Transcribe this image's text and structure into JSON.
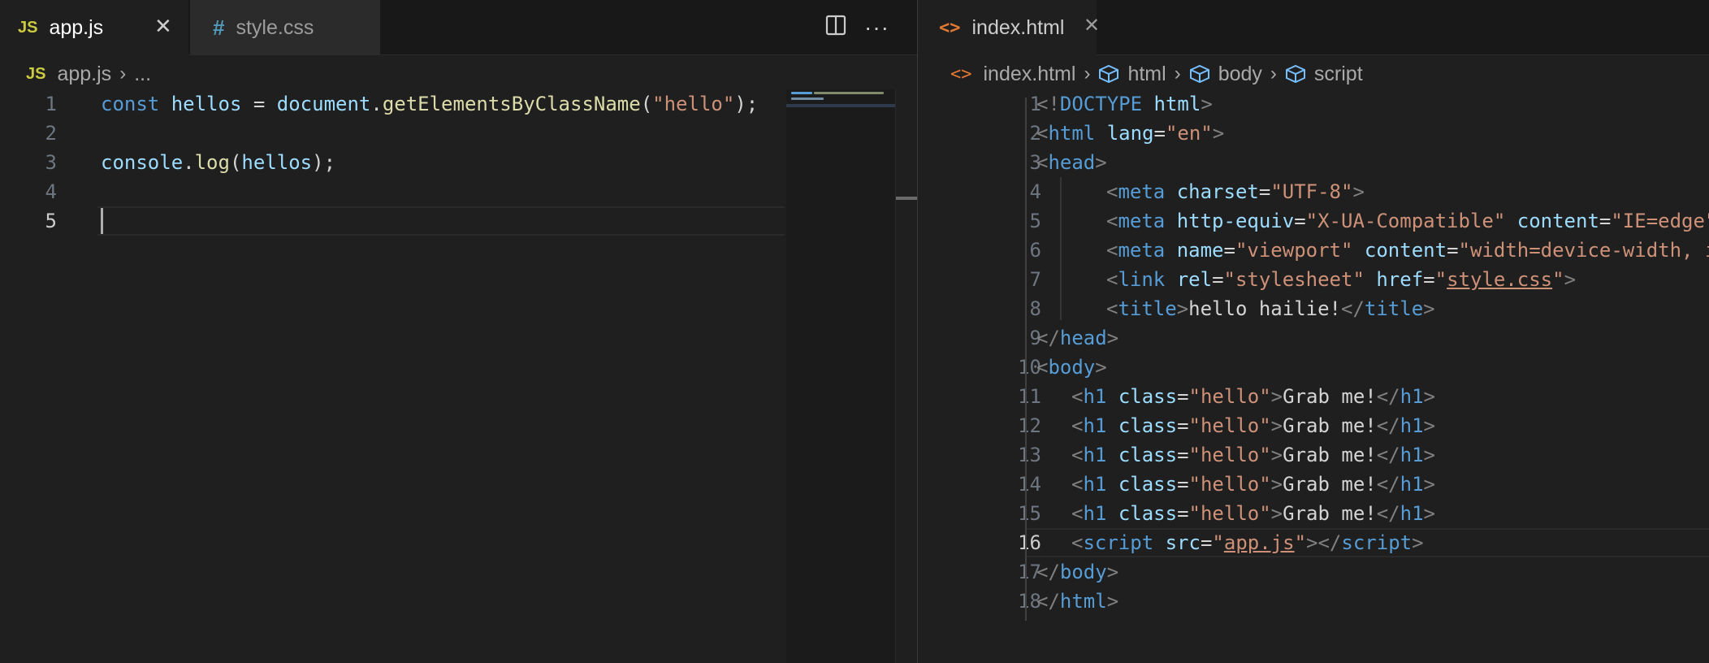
{
  "left": {
    "tabs": [
      {
        "label": "app.js",
        "icon": "js-icon",
        "icon_text": "JS",
        "active": true,
        "close": "✕"
      },
      {
        "label": "style.css",
        "icon": "hash-icon",
        "icon_text": "#",
        "active": false
      }
    ],
    "actions": {
      "split_icon": "split-editor-icon",
      "more": "···"
    },
    "breadcrumb": {
      "file_icon_text": "JS",
      "file": "app.js",
      "sep": "›",
      "rest": "..."
    },
    "lines": [
      {
        "n": "1",
        "tokens": [
          [
            "const",
            "kw"
          ],
          [
            " ",
            "plain"
          ],
          [
            "hellos",
            "var"
          ],
          [
            " = ",
            "plain"
          ],
          [
            "document",
            "var"
          ],
          [
            ".",
            "plain"
          ],
          [
            "getElementsByClassName",
            "fn"
          ],
          [
            "(",
            "plain"
          ],
          [
            "\"hello\"",
            "str"
          ],
          [
            ");",
            "plain"
          ]
        ]
      },
      {
        "n": "2",
        "tokens": []
      },
      {
        "n": "3",
        "tokens": [
          [
            "console",
            "var"
          ],
          [
            ".",
            "plain"
          ],
          [
            "log",
            "fn"
          ],
          [
            "(",
            "plain"
          ],
          [
            "hellos",
            "var"
          ],
          [
            ");",
            "plain"
          ]
        ]
      },
      {
        "n": "4",
        "tokens": []
      },
      {
        "n": "5",
        "tokens": [],
        "current": true
      }
    ]
  },
  "right": {
    "tabs": [
      {
        "label": "index.html",
        "icon": "html-icon",
        "icon_text": "<>",
        "active": true,
        "close": "✕"
      }
    ],
    "breadcrumb": {
      "file_icon_text": "<>",
      "file": "index.html",
      "sep": "›",
      "items": [
        "html",
        "body",
        "script"
      ]
    },
    "lines": [
      {
        "n": "1",
        "indent": 0,
        "tokens": [
          [
            "<!",
            "punct"
          ],
          [
            "DOCTYPE",
            "tag"
          ],
          [
            " ",
            "plain"
          ],
          [
            "html",
            "attr"
          ],
          [
            ">",
            "punct"
          ]
        ]
      },
      {
        "n": "2",
        "indent": 0,
        "tokens": [
          [
            "<",
            "punct"
          ],
          [
            "html",
            "tag"
          ],
          [
            " ",
            "plain"
          ],
          [
            "lang",
            "attr"
          ],
          [
            "=",
            "plain"
          ],
          [
            "\"en\"",
            "str"
          ],
          [
            ">",
            "punct"
          ]
        ]
      },
      {
        "n": "3",
        "indent": 0,
        "tokens": [
          [
            "<",
            "punct"
          ],
          [
            "head",
            "tag"
          ],
          [
            ">",
            "punct"
          ]
        ]
      },
      {
        "n": "4",
        "indent": 2,
        "tokens": [
          [
            "<",
            "punct"
          ],
          [
            "meta",
            "tag"
          ],
          [
            " ",
            "plain"
          ],
          [
            "charset",
            "attr"
          ],
          [
            "=",
            "plain"
          ],
          [
            "\"UTF-8\"",
            "str"
          ],
          [
            ">",
            "punct"
          ]
        ]
      },
      {
        "n": "5",
        "indent": 2,
        "tokens": [
          [
            "<",
            "punct"
          ],
          [
            "meta",
            "tag"
          ],
          [
            " ",
            "plain"
          ],
          [
            "http-equiv",
            "attr"
          ],
          [
            "=",
            "plain"
          ],
          [
            "\"X-UA-Compatible\"",
            "str"
          ],
          [
            " ",
            "plain"
          ],
          [
            "content",
            "attr"
          ],
          [
            "=",
            "plain"
          ],
          [
            "\"IE=edge\"",
            "str"
          ],
          [
            ">",
            "punct"
          ]
        ]
      },
      {
        "n": "6",
        "indent": 2,
        "tokens": [
          [
            "<",
            "punct"
          ],
          [
            "meta",
            "tag"
          ],
          [
            " ",
            "plain"
          ],
          [
            "name",
            "attr"
          ],
          [
            "=",
            "plain"
          ],
          [
            "\"viewport\"",
            "str"
          ],
          [
            " ",
            "plain"
          ],
          [
            "content",
            "attr"
          ],
          [
            "=",
            "plain"
          ],
          [
            "\"width=device-width, in",
            "str"
          ]
        ]
      },
      {
        "n": "7",
        "indent": 2,
        "tokens": [
          [
            "<",
            "punct"
          ],
          [
            "link",
            "tag"
          ],
          [
            " ",
            "plain"
          ],
          [
            "rel",
            "attr"
          ],
          [
            "=",
            "plain"
          ],
          [
            "\"stylesheet\"",
            "str"
          ],
          [
            " ",
            "plain"
          ],
          [
            "href",
            "attr"
          ],
          [
            "=",
            "plain"
          ],
          [
            "\"",
            "str"
          ],
          [
            "style.css",
            "link"
          ],
          [
            "\"",
            "str"
          ],
          [
            ">",
            "punct"
          ]
        ]
      },
      {
        "n": "8",
        "indent": 2,
        "tokens": [
          [
            "<",
            "punct"
          ],
          [
            "title",
            "tag"
          ],
          [
            ">",
            "punct"
          ],
          [
            "hello hailie!",
            "plain"
          ],
          [
            "</",
            "punct"
          ],
          [
            "title",
            "tag"
          ],
          [
            ">",
            "punct"
          ]
        ]
      },
      {
        "n": "9",
        "indent": 0,
        "tokens": [
          [
            "</",
            "punct"
          ],
          [
            "head",
            "tag"
          ],
          [
            ">",
            "punct"
          ]
        ]
      },
      {
        "n": "10",
        "indent": 0,
        "tokens": [
          [
            "<",
            "punct"
          ],
          [
            "body",
            "tag"
          ],
          [
            ">",
            "punct"
          ]
        ]
      },
      {
        "n": "11",
        "indent": 1,
        "tokens": [
          [
            "<",
            "punct"
          ],
          [
            "h1",
            "tag"
          ],
          [
            " ",
            "plain"
          ],
          [
            "class",
            "attr"
          ],
          [
            "=",
            "plain"
          ],
          [
            "\"hello\"",
            "str"
          ],
          [
            ">",
            "punct"
          ],
          [
            "Grab me!",
            "plain"
          ],
          [
            "</",
            "punct"
          ],
          [
            "h1",
            "tag"
          ],
          [
            ">",
            "punct"
          ]
        ]
      },
      {
        "n": "12",
        "indent": 1,
        "tokens": [
          [
            "<",
            "punct"
          ],
          [
            "h1",
            "tag"
          ],
          [
            " ",
            "plain"
          ],
          [
            "class",
            "attr"
          ],
          [
            "=",
            "plain"
          ],
          [
            "\"hello\"",
            "str"
          ],
          [
            ">",
            "punct"
          ],
          [
            "Grab me!",
            "plain"
          ],
          [
            "</",
            "punct"
          ],
          [
            "h1",
            "tag"
          ],
          [
            ">",
            "punct"
          ]
        ]
      },
      {
        "n": "13",
        "indent": 1,
        "tokens": [
          [
            "<",
            "punct"
          ],
          [
            "h1",
            "tag"
          ],
          [
            " ",
            "plain"
          ],
          [
            "class",
            "attr"
          ],
          [
            "=",
            "plain"
          ],
          [
            "\"hello\"",
            "str"
          ],
          [
            ">",
            "punct"
          ],
          [
            "Grab me!",
            "plain"
          ],
          [
            "</",
            "punct"
          ],
          [
            "h1",
            "tag"
          ],
          [
            ">",
            "punct"
          ]
        ]
      },
      {
        "n": "14",
        "indent": 1,
        "tokens": [
          [
            "<",
            "punct"
          ],
          [
            "h1",
            "tag"
          ],
          [
            " ",
            "plain"
          ],
          [
            "class",
            "attr"
          ],
          [
            "=",
            "plain"
          ],
          [
            "\"hello\"",
            "str"
          ],
          [
            ">",
            "punct"
          ],
          [
            "Grab me!",
            "plain"
          ],
          [
            "</",
            "punct"
          ],
          [
            "h1",
            "tag"
          ],
          [
            ">",
            "punct"
          ]
        ]
      },
      {
        "n": "15",
        "indent": 1,
        "tokens": [
          [
            "<",
            "punct"
          ],
          [
            "h1",
            "tag"
          ],
          [
            " ",
            "plain"
          ],
          [
            "class",
            "attr"
          ],
          [
            "=",
            "plain"
          ],
          [
            "\"hello\"",
            "str"
          ],
          [
            ">",
            "punct"
          ],
          [
            "Grab me!",
            "plain"
          ],
          [
            "</",
            "punct"
          ],
          [
            "h1",
            "tag"
          ],
          [
            ">",
            "punct"
          ]
        ]
      },
      {
        "n": "16",
        "indent": 1,
        "current": true,
        "tokens": [
          [
            "<",
            "punct"
          ],
          [
            "script",
            "tag"
          ],
          [
            " ",
            "plain"
          ],
          [
            "src",
            "attr"
          ],
          [
            "=",
            "plain"
          ],
          [
            "\"",
            "str"
          ],
          [
            "app.js",
            "link"
          ],
          [
            "\"",
            "str"
          ],
          [
            "></",
            "punct"
          ],
          [
            "script",
            "tag"
          ],
          [
            ">",
            "punct"
          ]
        ]
      },
      {
        "n": "17",
        "indent": 0,
        "tokens": [
          [
            "</",
            "punct"
          ],
          [
            "body",
            "tag"
          ],
          [
            ">",
            "punct"
          ]
        ]
      },
      {
        "n": "18",
        "indent": 0,
        "tokens": [
          [
            "</",
            "punct"
          ],
          [
            "html",
            "tag"
          ],
          [
            ">",
            "punct"
          ]
        ]
      }
    ]
  },
  "colors": {
    "keyword": "#569cd6",
    "variable": "#9cdcfe",
    "function": "#dcdcaa",
    "string": "#ce9178",
    "js_icon": "#cbcb41",
    "css_icon": "#519aba",
    "html_icon": "#e37933",
    "breadcrumb_symbol": "#75beff"
  }
}
